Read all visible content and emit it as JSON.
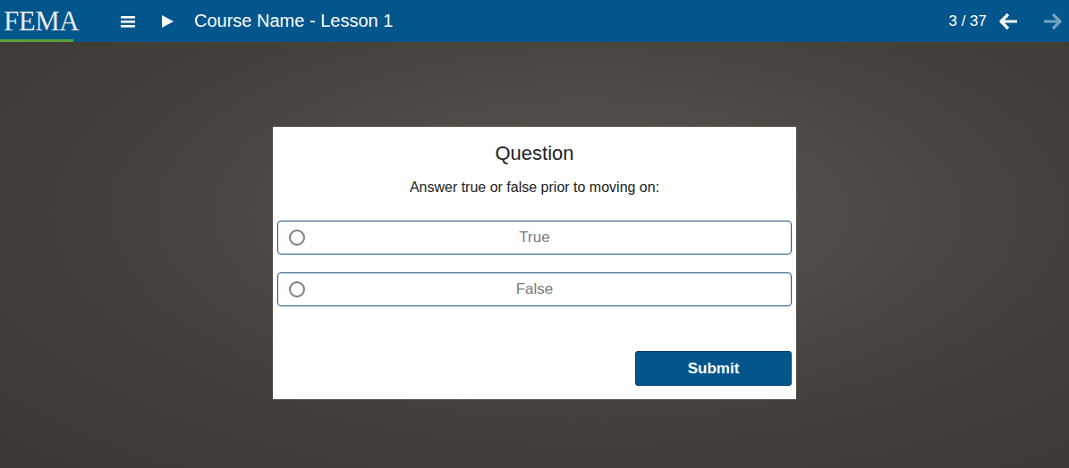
{
  "header": {
    "logo": "FEMA",
    "title": "Course Name - Lesson 1",
    "page_counter": "3 / 37",
    "prev_enabled": true,
    "next_enabled": false
  },
  "question": {
    "title": "Question",
    "prompt": "Answer true or false prior to moving on:",
    "options": [
      {
        "label": "True",
        "selected": false
      },
      {
        "label": "False",
        "selected": false
      }
    ],
    "submit": "Submit"
  }
}
